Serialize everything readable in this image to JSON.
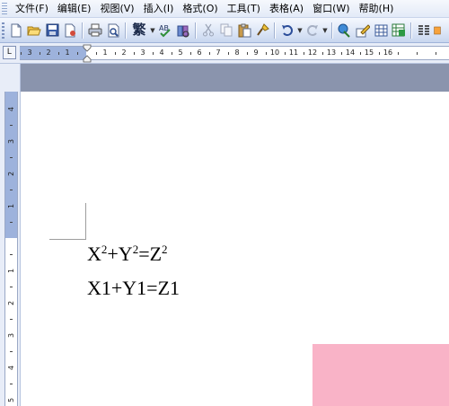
{
  "menu": {
    "items": [
      {
        "label": "文件(F)"
      },
      {
        "label": "编辑(E)"
      },
      {
        "label": "视图(V)"
      },
      {
        "label": "插入(I)"
      },
      {
        "label": "格式(O)"
      },
      {
        "label": "工具(T)"
      },
      {
        "label": "表格(A)"
      },
      {
        "label": "窗口(W)"
      },
      {
        "label": "帮助(H)"
      }
    ]
  },
  "toolbar": {
    "traditional_chinese_label": "繁"
  },
  "ruler": {
    "tab_selector": "L",
    "horizontal_numbers": [
      "3",
      "2",
      "1",
      "1",
      "2",
      "3",
      "4",
      "5",
      "6",
      "7",
      "8",
      "9",
      "10",
      "11",
      "12",
      "13",
      "14",
      "15",
      "16"
    ],
    "vertical_numbers": [
      "4",
      "3",
      "2",
      "1",
      "1",
      "2",
      "3",
      "4",
      "5"
    ]
  },
  "document": {
    "line1": {
      "parts": [
        "X",
        "2",
        "+Y",
        "2",
        "=Z",
        "2"
      ]
    },
    "line2": "X1+Y1=Z1"
  },
  "colors": {
    "ruler_margin": "#9db2dc",
    "gray_band": "#8a94ad",
    "pink_overlay": "#f9b3c7"
  }
}
